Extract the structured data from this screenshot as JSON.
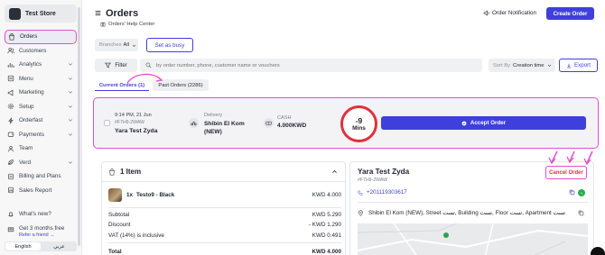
{
  "sidebar": {
    "store_name": "Test Store",
    "items": [
      {
        "label": "Orders",
        "icon": "bag-icon",
        "active": true,
        "has_chevron": false
      },
      {
        "label": "Customers",
        "icon": "users-icon",
        "has_chevron": false
      },
      {
        "label": "Analytics",
        "icon": "chart-icon",
        "has_chevron": true
      },
      {
        "label": "Menu",
        "icon": "menu-book-icon",
        "has_chevron": true
      },
      {
        "label": "Marketing",
        "icon": "megaphone-icon",
        "has_chevron": true
      },
      {
        "label": "Setup",
        "icon": "gear-icon",
        "has_chevron": true
      },
      {
        "label": "Orderfast",
        "icon": "lightning-icon",
        "has_chevron": true
      },
      {
        "label": "Payments",
        "icon": "wallet-icon",
        "has_chevron": true
      },
      {
        "label": "Team",
        "icon": "team-icon",
        "has_chevron": false
      },
      {
        "label": "Verd",
        "icon": "leaf-icon",
        "has_chevron": true
      },
      {
        "label": "Billing and Plans",
        "icon": "billing-icon",
        "has_chevron": false
      },
      {
        "label": "Sales Report",
        "icon": "report-icon",
        "has_chevron": false
      }
    ],
    "whats_new": "What's new?",
    "promo_title": "Get 3 months free",
    "promo_link": "Refer a friend →",
    "lang": {
      "en": "English",
      "ar": "عربي"
    }
  },
  "header": {
    "title": "Orders",
    "help": "Orders' Help Center",
    "notification": "Order Notification",
    "create_button": "Create Order"
  },
  "filters": {
    "branches_label": "Branches",
    "branches_value": "All",
    "busy_button": "Set as busy",
    "filter_button": "Filter",
    "search_placeholder": "by order number, phone, customer name or vouchers",
    "sort_label": "Sort By",
    "sort_value": "Creation time",
    "export_button": "Export"
  },
  "tabs": {
    "current": "Current Orders (1)",
    "past": "Past Orders (2286)"
  },
  "order": {
    "datetime": "9:14 PM, 21 Jun",
    "code": "#F7H9-2WAW",
    "customer": "Yara Test Zyda",
    "delivery_label": "Delivery",
    "delivery_area": "Shibin El Kom",
    "delivery_area2": "(NEW)",
    "payment_label": "CASH",
    "amount": "4.000KWD",
    "timer_value": "-9",
    "timer_unit": "Mins",
    "accept_button": "Accept Order"
  },
  "details": {
    "items_count": "1 Item",
    "item_qty": "1x",
    "item_name": "Testo9 - Black",
    "item_price": "KWD 4.000",
    "subtotal_label": "Subtotal",
    "subtotal_value": "KWD 5.290",
    "discount_label": "Discount",
    "discount_value": "- KWD 1.290",
    "vat_label": "VAT (14%) is inclusive",
    "vat_value": "KWD 0.491",
    "total_label": "Total",
    "total_value": "KWD 4.000"
  },
  "customer": {
    "name": "Yara Test Zyda",
    "code": "#F7H9-2WAW",
    "cancel_button": "Cancel Order",
    "phone": "+201119303617",
    "address": "Shibin El Kom (NEW), Street تست, Building تست, Floor تست, Apartment تست"
  },
  "colors": {
    "accent": "#3f3fdc",
    "annotation": "#e64dcf",
    "timer_ring": "#e0313b",
    "cancel_text": "#e0313b"
  }
}
